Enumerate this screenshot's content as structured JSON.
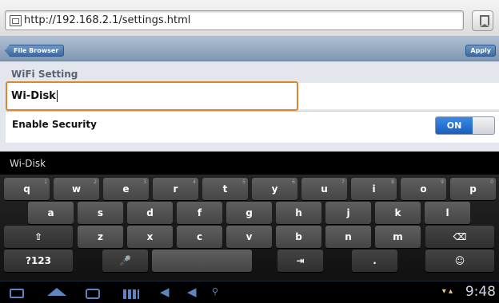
{
  "browser": {
    "url": "http://192.168.2.1/settings.html"
  },
  "header": {
    "back_label": "File Browser",
    "apply_label": "Apply"
  },
  "settings": {
    "section_title": "WiFi Setting",
    "ssid_value": "Wi-Disk",
    "security_label": "Enable Security",
    "security_toggle": "ON"
  },
  "keyboard": {
    "suggestion": "Wi-Disk",
    "row1": [
      "q",
      "w",
      "e",
      "r",
      "t",
      "y",
      "u",
      "i",
      "o",
      "p"
    ],
    "row1_hints": [
      "1",
      "2",
      "3",
      "4",
      "5",
      "6",
      "7",
      "8",
      "9",
      "0"
    ],
    "row2": [
      "a",
      "s",
      "d",
      "f",
      "g",
      "h",
      "j",
      "k",
      "l"
    ],
    "row3": [
      "z",
      "x",
      "c",
      "v",
      "b",
      "n",
      "m"
    ],
    "mode_key": "?123",
    "dot_key": "."
  },
  "statusbar": {
    "time": "9:48",
    "icons": "▾ ▴"
  },
  "colors": {
    "focus_border": "#e0842b",
    "toggle_on": "#1a5fbf",
    "header": "#7f97b1"
  }
}
